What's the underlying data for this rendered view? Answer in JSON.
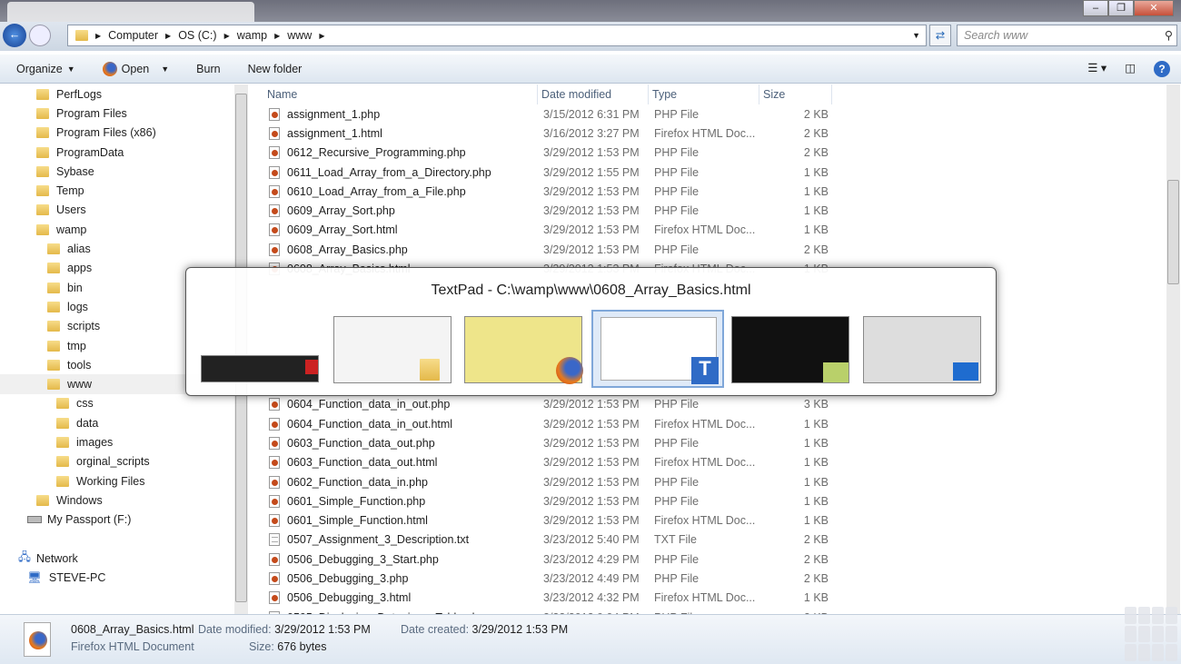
{
  "window": {
    "ghost_tab": "0608_Array_Basics"
  },
  "address": {
    "crumbs": [
      "Computer",
      "OS (C:)",
      "wamp",
      "www"
    ]
  },
  "search": {
    "placeholder": "Search www"
  },
  "toolbar": {
    "organize": "Organize",
    "open": "Open",
    "burn": "Burn",
    "new_folder": "New folder"
  },
  "tree": [
    {
      "label": "PerfLogs",
      "level": 1
    },
    {
      "label": "Program Files",
      "level": 1
    },
    {
      "label": "Program Files (x86)",
      "level": 1
    },
    {
      "label": "ProgramData",
      "level": 1
    },
    {
      "label": "Sybase",
      "level": 1
    },
    {
      "label": "Temp",
      "level": 1
    },
    {
      "label": "Users",
      "level": 1
    },
    {
      "label": "wamp",
      "level": 1
    },
    {
      "label": "alias",
      "level": 2
    },
    {
      "label": "apps",
      "level": 2
    },
    {
      "label": "bin",
      "level": 2
    },
    {
      "label": "logs",
      "level": 2
    },
    {
      "label": "scripts",
      "level": 2
    },
    {
      "label": "tmp",
      "level": 2
    },
    {
      "label": "tools",
      "level": 2
    },
    {
      "label": "www",
      "level": 2,
      "selected": true
    },
    {
      "label": "css",
      "level": 3
    },
    {
      "label": "data",
      "level": 3
    },
    {
      "label": "images",
      "level": 3
    },
    {
      "label": "orginal_scripts",
      "level": 3
    },
    {
      "label": "Working Files",
      "level": 3
    },
    {
      "label": "Windows",
      "level": 1
    },
    {
      "label": "My Passport (F:)",
      "level": 0,
      "icon": "drive"
    },
    {
      "label": "",
      "level": 0,
      "icon": "none"
    },
    {
      "label": "Network",
      "level": 0,
      "icon": "network"
    },
    {
      "label": "STEVE-PC",
      "level": 1,
      "icon": "computer"
    }
  ],
  "columns": {
    "name": "Name",
    "date": "Date modified",
    "type": "Type",
    "size": "Size"
  },
  "files_above": [
    [
      "assignment_1.php",
      "3/15/2012 6:31 PM",
      "PHP File",
      "2 KB"
    ],
    [
      "assignment_1.html",
      "3/16/2012 3:27 PM",
      "Firefox HTML Doc...",
      "2 KB"
    ],
    [
      "0612_Recursive_Programming.php",
      "3/29/2012 1:53 PM",
      "PHP File",
      "2 KB"
    ],
    [
      "0611_Load_Array_from_a_Directory.php",
      "3/29/2012 1:55 PM",
      "PHP File",
      "1 KB"
    ],
    [
      "0610_Load_Array_from_a_File.php",
      "3/29/2012 1:53 PM",
      "PHP File",
      "1 KB"
    ],
    [
      "0609_Array_Sort.php",
      "3/29/2012 1:53 PM",
      "PHP File",
      "1 KB"
    ],
    [
      "0609_Array_Sort.html",
      "3/29/2012 1:53 PM",
      "Firefox HTML Doc...",
      "1 KB"
    ],
    [
      "0608_Array_Basics.php",
      "3/29/2012 1:53 PM",
      "PHP File",
      "2 KB"
    ],
    [
      "0608_Array_Basics.html",
      "3/29/2012 1:53 PM",
      "Firefox HTML Doc...",
      "1 KB"
    ]
  ],
  "files_below": [
    [
      "0604_Function_data_in_out.php",
      "3/29/2012 1:53 PM",
      "PHP File",
      "3 KB"
    ],
    [
      "0604_Function_data_in_out.html",
      "3/29/2012 1:53 PM",
      "Firefox HTML Doc...",
      "1 KB"
    ],
    [
      "0603_Function_data_out.php",
      "3/29/2012 1:53 PM",
      "PHP File",
      "1 KB"
    ],
    [
      "0603_Function_data_out.html",
      "3/29/2012 1:53 PM",
      "Firefox HTML Doc...",
      "1 KB"
    ],
    [
      "0602_Function_data_in.php",
      "3/29/2012 1:53 PM",
      "PHP File",
      "1 KB"
    ],
    [
      "0601_Simple_Function.php",
      "3/29/2012 1:53 PM",
      "PHP File",
      "1 KB"
    ],
    [
      "0601_Simple_Function.html",
      "3/29/2012 1:53 PM",
      "Firefox HTML Doc...",
      "1 KB"
    ],
    [
      "0507_Assignment_3_Description.txt",
      "3/23/2012 5:40 PM",
      "TXT File",
      "2 KB"
    ],
    [
      "0506_Debugging_3_Start.php",
      "3/23/2012 4:29 PM",
      "PHP File",
      "2 KB"
    ],
    [
      "0506_Debugging_3.php",
      "3/23/2012 4:49 PM",
      "PHP File",
      "2 KB"
    ],
    [
      "0506_Debugging_3.html",
      "3/23/2012 4:32 PM",
      "Firefox HTML Doc...",
      "1 KB"
    ],
    [
      "0505_Displaying_Data_in_a_Table.php",
      "3/23/2012 9:04 PM",
      "PHP File",
      "2 KB"
    ]
  ],
  "details": {
    "name": "0608_Array_Basics.html",
    "type": "Firefox HTML Document",
    "modified_label": "Date modified:",
    "modified": "3/29/2012 1:53 PM",
    "created_label": "Date created:",
    "created": "3/29/2012 1:53 PM",
    "size_label": "Size:",
    "size": "676 bytes"
  },
  "switcher": {
    "title": "TextPad - C:\\wamp\\www\\0608_Array_Basics.html",
    "windows": [
      "media-player",
      "explorer",
      "firefox",
      "textpad",
      "video-editor",
      "desktop"
    ],
    "active": "textpad"
  }
}
